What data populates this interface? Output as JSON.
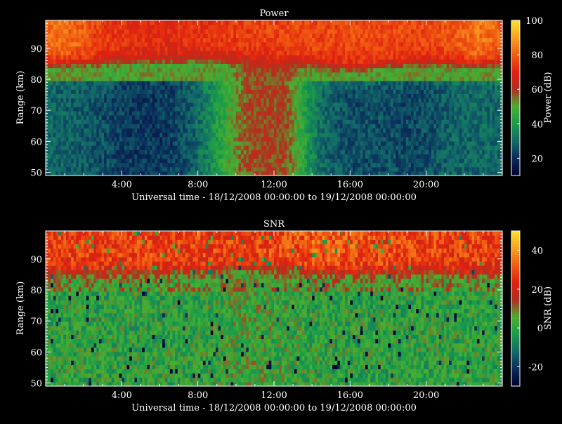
{
  "chart_data": [
    {
      "type": "heatmap",
      "title": "Power",
      "xlabel": "Universal time - 18/12/2008 00:00:00 to 19/12/2008 00:00:00",
      "ylabel": "Range (km)",
      "xlim": [
        0,
        24
      ],
      "ylim": [
        49,
        99
      ],
      "x_ticklabels": [
        "4:00",
        "8:00",
        "12:00",
        "16:00",
        "20:00"
      ],
      "x_tickvalues": [
        4,
        8,
        12,
        16,
        20
      ],
      "y_ticklabels": [
        "50",
        "60",
        "70",
        "80",
        "90"
      ],
      "y_tickvalues": [
        50,
        60,
        70,
        80,
        90
      ],
      "colorbar": {
        "label": "Power (dB)",
        "range": [
          10,
          100
        ],
        "ticklabels": [
          "20",
          "40",
          "60",
          "80",
          "100"
        ],
        "tickvalues": [
          20,
          40,
          60,
          80,
          100
        ]
      },
      "grid": false,
      "colormap": [
        "#000030",
        "#0a2a5a",
        "#126a6a",
        "#1a9a4a",
        "#48b030",
        "#b03020",
        "#e02010",
        "#f05a10",
        "#f8a020",
        "#ffe030"
      ]
    },
    {
      "type": "heatmap",
      "title": "SNR",
      "xlabel": "Universal time - 18/12/2008 00:00:00 to 19/12/2008 00:00:00",
      "ylabel": "Range (km)",
      "xlim": [
        0,
        24
      ],
      "ylim": [
        49,
        99
      ],
      "x_ticklabels": [
        "4:00",
        "8:00",
        "12:00",
        "16:00",
        "20:00"
      ],
      "x_tickvalues": [
        4,
        8,
        12,
        16,
        20
      ],
      "y_ticklabels": [
        "50",
        "60",
        "70",
        "80",
        "90"
      ],
      "y_tickvalues": [
        50,
        60,
        70,
        80,
        90
      ],
      "colorbar": {
        "label": "SNR (dB)",
        "range": [
          -30,
          50
        ],
        "ticklabels": [
          "-20",
          "0",
          "20",
          "40"
        ],
        "tickvalues": [
          -20,
          0,
          20,
          40
        ]
      },
      "grid": false,
      "colormap": [
        "#000030",
        "#0a2a5a",
        "#126a6a",
        "#1a9a4a",
        "#48b030",
        "#b03020",
        "#e02010",
        "#f05a10",
        "#f8a020",
        "#ffe030"
      ]
    }
  ]
}
